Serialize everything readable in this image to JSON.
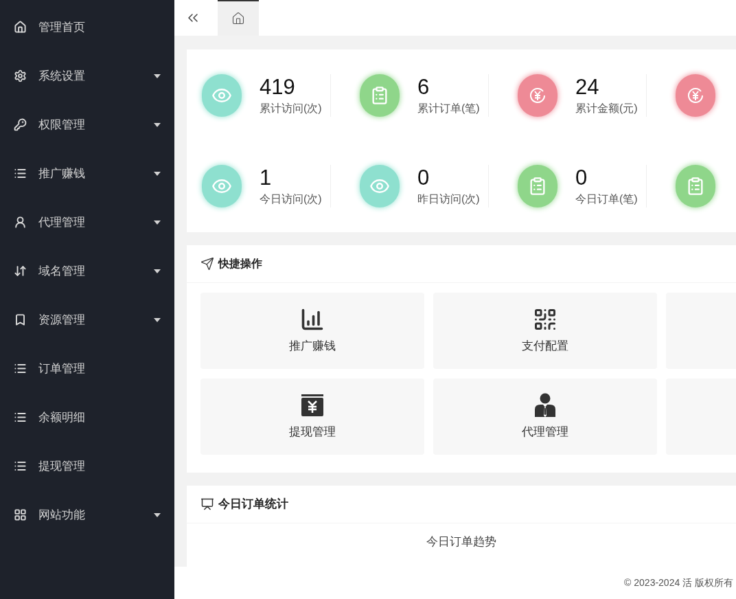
{
  "sidebar": {
    "items": [
      {
        "label": "管理首页",
        "kind": "home",
        "has_submenu": false
      },
      {
        "label": "系统设置",
        "kind": "gear",
        "has_submenu": true
      },
      {
        "label": "权限管理",
        "kind": "key",
        "has_submenu": true
      },
      {
        "label": "推广赚钱",
        "kind": "list",
        "has_submenu": true
      },
      {
        "label": "代理管理",
        "kind": "user",
        "has_submenu": true
      },
      {
        "label": "域名管理",
        "kind": "sort",
        "has_submenu": true
      },
      {
        "label": "资源管理",
        "kind": "bookmark",
        "has_submenu": true
      },
      {
        "label": "订单管理",
        "kind": "list",
        "has_submenu": false
      },
      {
        "label": "余额明细",
        "kind": "list",
        "has_submenu": false
      },
      {
        "label": "提现管理",
        "kind": "list",
        "has_submenu": false
      },
      {
        "label": "网站功能",
        "kind": "grid",
        "has_submenu": true
      }
    ]
  },
  "tabs": [
    {
      "kind": "home",
      "selected": true
    }
  ],
  "stats": {
    "rows": [
      [
        {
          "kind": "eye",
          "color": "#8ee0cf",
          "value": "419",
          "label": "累计访问(次)"
        },
        {
          "kind": "clipboard",
          "color": "#8fd68a",
          "value": "6",
          "label": "累计订单(笔)"
        },
        {
          "kind": "yen",
          "color": "#ee8a96",
          "value": "24",
          "label": "累计金额(元)"
        },
        {
          "kind": "yen",
          "color": "#ee8a96"
        }
      ],
      [
        {
          "kind": "eye",
          "color": "#8ee0cf",
          "value": "1",
          "label": "今日访问(次)"
        },
        {
          "kind": "eye",
          "color": "#8ee0cf",
          "value": "0",
          "label": "昨日访问(次)"
        },
        {
          "kind": "clipboard",
          "color": "#8fd68a",
          "value": "0",
          "label": "今日订单(笔)"
        },
        {
          "kind": "clipboard",
          "color": "#8fd68a"
        }
      ]
    ]
  },
  "quick_actions": {
    "title": "快捷操作",
    "tiles": [
      {
        "kind": "chart",
        "label": "推广赚钱"
      },
      {
        "kind": "qr",
        "label": "支付配置"
      },
      {
        "kind": "blank"
      },
      {
        "kind": "wallet",
        "label": "提现管理"
      },
      {
        "kind": "agent",
        "label": "代理管理"
      },
      {
        "kind": "blank"
      }
    ]
  },
  "order_stats": {
    "title": "今日订单统计",
    "chart_title": "今日订单趋势"
  },
  "footer": "© 2023-2024 活 版权所有"
}
